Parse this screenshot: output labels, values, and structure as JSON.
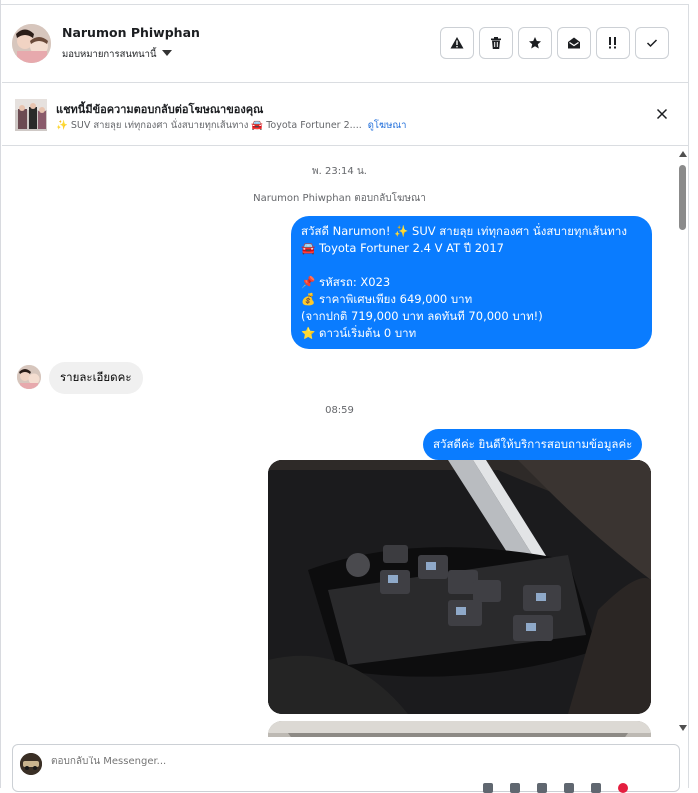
{
  "header": {
    "contact_name": "Narumon Phiwphan",
    "assign_label": "มอบหมายการสนทนานี้",
    "actions": [
      {
        "name": "report-spam-button",
        "icon": "warning-icon"
      },
      {
        "name": "delete-button",
        "icon": "trash-icon"
      },
      {
        "name": "star-button",
        "icon": "star-icon"
      },
      {
        "name": "mark-unread-button",
        "icon": "envelope-open-icon"
      },
      {
        "name": "follow-up-button",
        "icon": "flag-exclamation-icon"
      },
      {
        "name": "mark-done-button",
        "icon": "check-icon"
      }
    ]
  },
  "ad_banner": {
    "title": "แชทนี้มีข้อความตอบกลับต่อโฆษณาของคุณ",
    "subtitle": "✨ SUV สายลุย เท่ทุกองศา นั่งสบายทุกเส้นทาง 🚘 Toyota Fortuner 2....",
    "link": "ดูโฆษณา"
  },
  "chat": {
    "time_1": "พ. 23:14 น.",
    "replied_ad": "Narumon Phiwphan ตอบกลับโฆษณา",
    "ad_message": "สวัสดี Narumon! ✨ SUV สายลุย เท่ทุกองศา นั่งสบายทุกเส้นทาง\n🚘 Toyota Fortuner 2.4 V AT ปี 2017\n\n📌 รหัสรถ: X023\n💰 ราคาพิเศษเพียง 649,000 บาท\n(จากปกติ 719,000 บาท ลดทันที 70,000 บาท!)\n⭐ ดาวน์เริ่มต้น 0 บาท",
    "incoming_message": "รายละเอียดคะ",
    "time_2": "08:59",
    "greeting_message": "สวัสดีค่ะ  ยินดีให้บริการสอบถามข้อมูลค่ะ"
  },
  "composer": {
    "placeholder": "ตอบกลับใน Messenger..."
  },
  "colors": {
    "outgoing_bubble": "#0a7cff",
    "incoming_bubble": "#f0f0f0",
    "link": "#216fdb"
  }
}
